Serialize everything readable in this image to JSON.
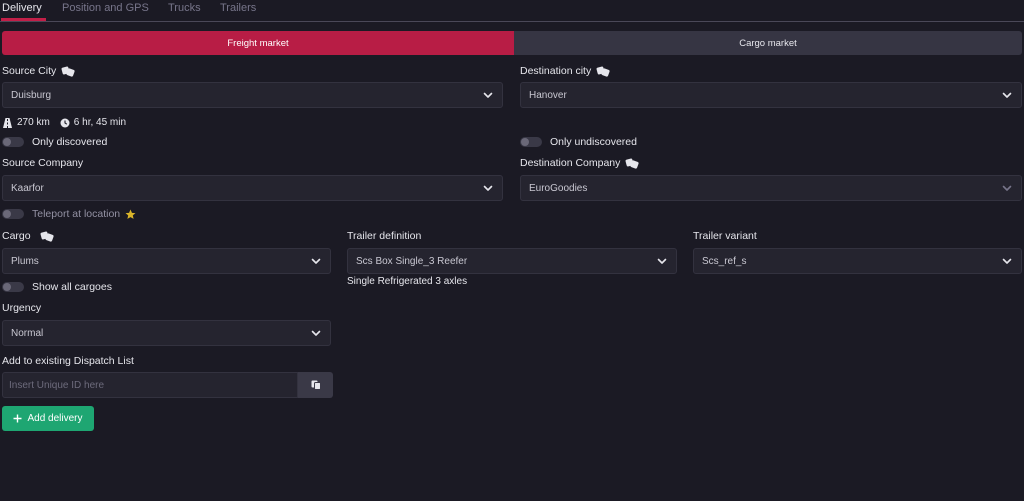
{
  "tabs": [
    {
      "label": "Delivery"
    },
    {
      "label": "Position and GPS"
    },
    {
      "label": "Trucks"
    },
    {
      "label": "Trailers"
    }
  ],
  "market": {
    "freight": "Freight market",
    "cargo": "Cargo market"
  },
  "source_city": {
    "label": "Source City",
    "value": "Duisburg"
  },
  "destination_city": {
    "label": "Destination city",
    "value": "Hanover"
  },
  "route": {
    "distance": "270 km",
    "duration": "6 hr, 45 min"
  },
  "toggles": {
    "only_discovered": "Only discovered",
    "only_undiscovered": "Only undiscovered",
    "teleport": "Teleport at location",
    "show_all_cargoes": "Show all cargoes"
  },
  "source_company": {
    "label": "Source Company",
    "value": "Kaarfor"
  },
  "destination_company": {
    "label": "Destination Company",
    "value": "EuroGoodies"
  },
  "cargo": {
    "label": "Cargo",
    "value": "Plums"
  },
  "trailer_definition": {
    "label": "Trailer definition",
    "value": "Scs Box Single_3 Reefer",
    "description": "Single Refrigerated 3 axles"
  },
  "trailer_variant": {
    "label": "Trailer variant",
    "value": "Scs_ref_s"
  },
  "urgency": {
    "label": "Urgency",
    "value": "Normal"
  },
  "dispatch": {
    "label": "Add to existing Dispatch List",
    "placeholder": "Insert Unique ID here"
  },
  "add_delivery": {
    "label": "Add delivery"
  },
  "colors": {
    "accent": "#b81d45",
    "success": "#1ea672",
    "background": "#1b1a24",
    "star": "#d9b42a"
  }
}
